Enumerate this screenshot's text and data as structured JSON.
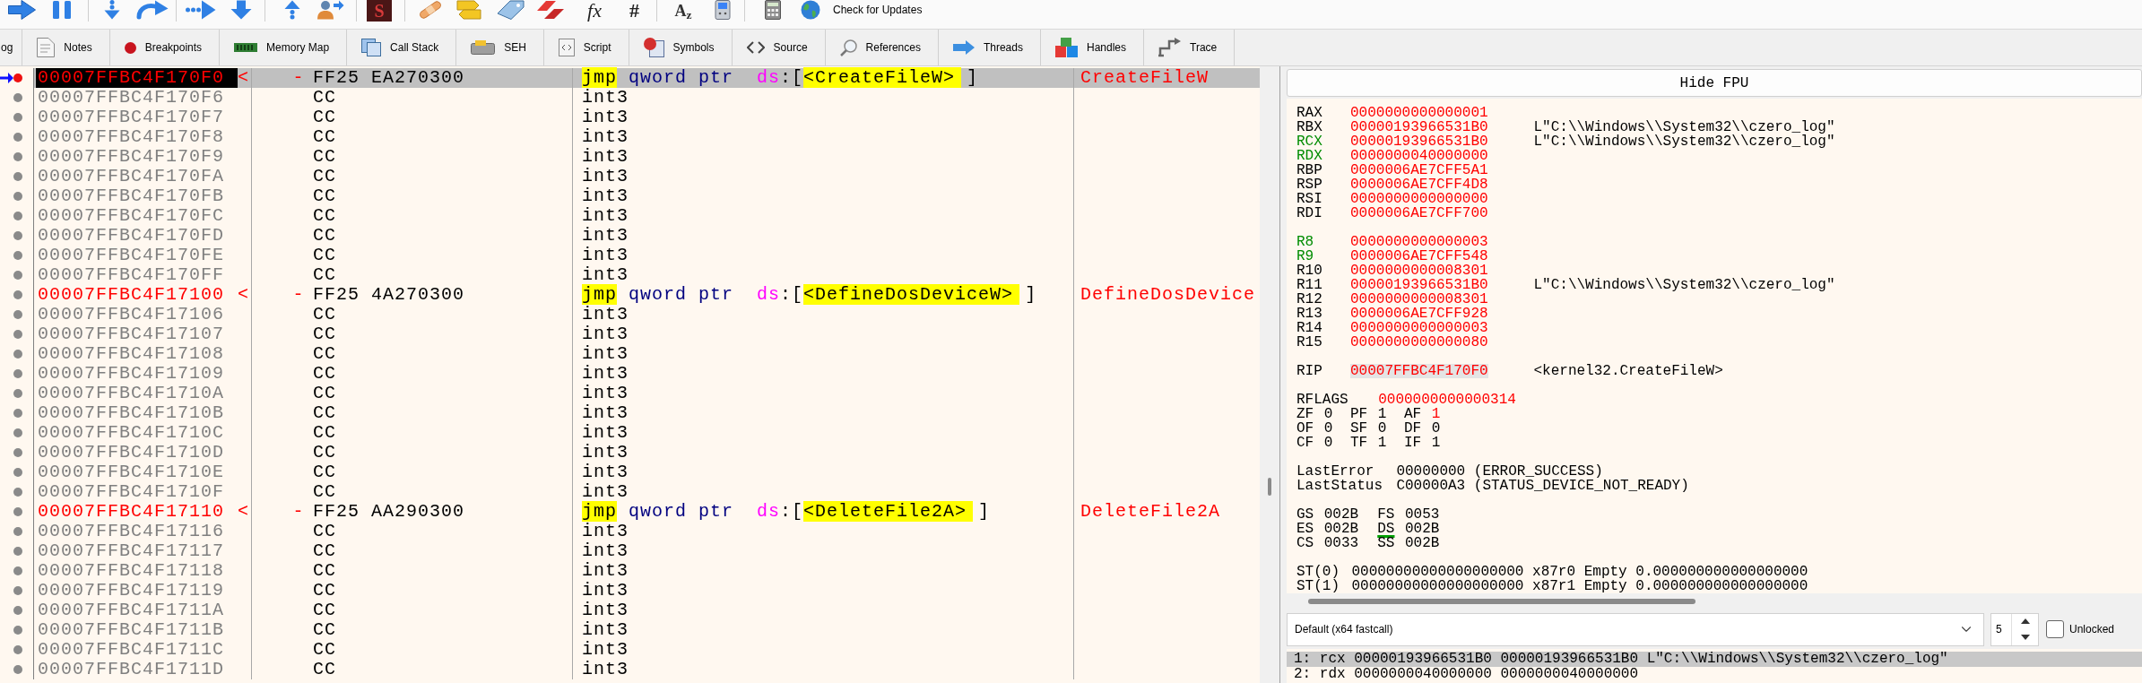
{
  "toolbar": {
    "letter_button": "S",
    "fx_button": "fx",
    "hash_button": "#",
    "az_button": "A$_{z}$",
    "updates_button": "Check for Updates"
  },
  "tabs": [
    {
      "label": "og",
      "kind": "log",
      "selected": false
    },
    {
      "label": "Notes",
      "kind": "notes",
      "selected": false
    },
    {
      "label": "Breakpoints",
      "kind": "breakpoints",
      "selected": false
    },
    {
      "label": "Memory Map",
      "kind": "memory",
      "selected": false
    },
    {
      "label": "Call Stack",
      "kind": "callstack",
      "selected": false
    },
    {
      "label": "SEH",
      "kind": "seh",
      "selected": false
    },
    {
      "label": "Script",
      "kind": "script",
      "selected": false
    },
    {
      "label": "Symbols",
      "kind": "symbols",
      "selected": false
    },
    {
      "label": "Source",
      "kind": "source",
      "selected": false
    },
    {
      "label": "References",
      "kind": "references",
      "selected": false
    },
    {
      "label": "Threads",
      "kind": "threads",
      "selected": false
    },
    {
      "label": "Handles",
      "kind": "handles",
      "selected": false
    },
    {
      "label": "Trace",
      "kind": "trace",
      "selected": false
    }
  ],
  "disassembly": {
    "rows": [
      {
        "address": "00007FFBC4F170F0",
        "address_mark": "<",
        "branch_mark": "-",
        "bytes": "FF25 EA270300",
        "instruction": [
          {
            "text": "jmp",
            "kind": "branch"
          },
          {
            "text": "qword ptr",
            "kind": "size"
          },
          {
            "text": "ds",
            "kind": "segment"
          },
          {
            "text": ":[",
            "kind": "open"
          },
          {
            "text": "<CreateFileW>",
            "kind": "symbol"
          },
          {
            "text": "]",
            "kind": "close"
          }
        ],
        "comment": "CreateFileW",
        "labeled": true,
        "current": true,
        "selected": true,
        "breakpoint": true
      },
      {
        "address": "00007FFBC4F170F6",
        "bytes": "CC",
        "instruction": [
          {
            "text": "int3",
            "kind": "mnemonic"
          }
        ],
        "labeled": false,
        "current": false,
        "selected": false,
        "breakpoint": false
      },
      {
        "address": "00007FFBC4F170F7",
        "bytes": "CC",
        "instruction": [
          {
            "text": "int3",
            "kind": "mnemonic"
          }
        ],
        "labeled": false,
        "current": false,
        "selected": false,
        "breakpoint": false
      },
      {
        "address": "00007FFBC4F170F8",
        "bytes": "CC",
        "instruction": [
          {
            "text": "int3",
            "kind": "mnemonic"
          }
        ],
        "labeled": false,
        "current": false,
        "selected": false,
        "breakpoint": false
      },
      {
        "address": "00007FFBC4F170F9",
        "bytes": "CC",
        "instruction": [
          {
            "text": "int3",
            "kind": "mnemonic"
          }
        ],
        "labeled": false,
        "current": false,
        "selected": false,
        "breakpoint": false
      },
      {
        "address": "00007FFBC4F170FA",
        "bytes": "CC",
        "instruction": [
          {
            "text": "int3",
            "kind": "mnemonic"
          }
        ],
        "labeled": false,
        "current": false,
        "selected": false,
        "breakpoint": false
      },
      {
        "address": "00007FFBC4F170FB",
        "bytes": "CC",
        "instruction": [
          {
            "text": "int3",
            "kind": "mnemonic"
          }
        ],
        "labeled": false,
        "current": false,
        "selected": false,
        "breakpoint": false
      },
      {
        "address": "00007FFBC4F170FC",
        "bytes": "CC",
        "instruction": [
          {
            "text": "int3",
            "kind": "mnemonic"
          }
        ],
        "labeled": false,
        "current": false,
        "selected": false,
        "breakpoint": false
      },
      {
        "address": "00007FFBC4F170FD",
        "bytes": "CC",
        "instruction": [
          {
            "text": "int3",
            "kind": "mnemonic"
          }
        ],
        "labeled": false,
        "current": false,
        "selected": false,
        "breakpoint": false
      },
      {
        "address": "00007FFBC4F170FE",
        "bytes": "CC",
        "instruction": [
          {
            "text": "int3",
            "kind": "mnemonic"
          }
        ],
        "labeled": false,
        "current": false,
        "selected": false,
        "breakpoint": false
      },
      {
        "address": "00007FFBC4F170FF",
        "bytes": "CC",
        "instruction": [
          {
            "text": "int3",
            "kind": "mnemonic"
          }
        ],
        "labeled": false,
        "current": false,
        "selected": false,
        "breakpoint": false
      },
      {
        "address": "00007FFBC4F17100",
        "address_mark": "<",
        "branch_mark": "-",
        "bytes": "FF25 4A270300",
        "instruction": [
          {
            "text": "jmp",
            "kind": "branch"
          },
          {
            "text": "qword ptr",
            "kind": "size"
          },
          {
            "text": "ds",
            "kind": "segment"
          },
          {
            "text": ":[",
            "kind": "open"
          },
          {
            "text": "<DefineDosDeviceW>",
            "kind": "symbol"
          },
          {
            "text": "]",
            "kind": "close"
          }
        ],
        "comment": "DefineDosDevice",
        "labeled": true,
        "current": false,
        "selected": false,
        "breakpoint": false
      },
      {
        "address": "00007FFBC4F17106",
        "bytes": "CC",
        "instruction": [
          {
            "text": "int3",
            "kind": "mnemonic"
          }
        ],
        "labeled": false,
        "current": false,
        "selected": false,
        "breakpoint": false
      },
      {
        "address": "00007FFBC4F17107",
        "bytes": "CC",
        "instruction": [
          {
            "text": "int3",
            "kind": "mnemonic"
          }
        ],
        "labeled": false,
        "current": false,
        "selected": false,
        "breakpoint": false
      },
      {
        "address": "00007FFBC4F17108",
        "bytes": "CC",
        "instruction": [
          {
            "text": "int3",
            "kind": "mnemonic"
          }
        ],
        "labeled": false,
        "current": false,
        "selected": false,
        "breakpoint": false
      },
      {
        "address": "00007FFBC4F17109",
        "bytes": "CC",
        "instruction": [
          {
            "text": "int3",
            "kind": "mnemonic"
          }
        ],
        "labeled": false,
        "current": false,
        "selected": false,
        "breakpoint": false
      },
      {
        "address": "00007FFBC4F1710A",
        "bytes": "CC",
        "instruction": [
          {
            "text": "int3",
            "kind": "mnemonic"
          }
        ],
        "labeled": false,
        "current": false,
        "selected": false,
        "breakpoint": false
      },
      {
        "address": "00007FFBC4F1710B",
        "bytes": "CC",
        "instruction": [
          {
            "text": "int3",
            "kind": "mnemonic"
          }
        ],
        "labeled": false,
        "current": false,
        "selected": false,
        "breakpoint": false
      },
      {
        "address": "00007FFBC4F1710C",
        "bytes": "CC",
        "instruction": [
          {
            "text": "int3",
            "kind": "mnemonic"
          }
        ],
        "labeled": false,
        "current": false,
        "selected": false,
        "breakpoint": false
      },
      {
        "address": "00007FFBC4F1710D",
        "bytes": "CC",
        "instruction": [
          {
            "text": "int3",
            "kind": "mnemonic"
          }
        ],
        "labeled": false,
        "current": false,
        "selected": false,
        "breakpoint": false
      },
      {
        "address": "00007FFBC4F1710E",
        "bytes": "CC",
        "instruction": [
          {
            "text": "int3",
            "kind": "mnemonic"
          }
        ],
        "labeled": false,
        "current": false,
        "selected": false,
        "breakpoint": false
      },
      {
        "address": "00007FFBC4F1710F",
        "bytes": "CC",
        "instruction": [
          {
            "text": "int3",
            "kind": "mnemonic"
          }
        ],
        "labeled": false,
        "current": false,
        "selected": false,
        "breakpoint": false
      },
      {
        "address": "00007FFBC4F17110",
        "address_mark": "<",
        "branch_mark": "-",
        "bytes": "FF25 AA290300",
        "instruction": [
          {
            "text": "jmp",
            "kind": "branch"
          },
          {
            "text": "qword ptr",
            "kind": "size"
          },
          {
            "text": "ds",
            "kind": "segment"
          },
          {
            "text": ":[",
            "kind": "open"
          },
          {
            "text": "<DeleteFile2A>",
            "kind": "symbol"
          },
          {
            "text": "]",
            "kind": "close"
          }
        ],
        "comment": "DeleteFile2A",
        "labeled": true,
        "current": false,
        "selected": false,
        "breakpoint": false
      },
      {
        "address": "00007FFBC4F17116",
        "bytes": "CC",
        "instruction": [
          {
            "text": "int3",
            "kind": "mnemonic"
          }
        ],
        "labeled": false,
        "current": false,
        "selected": false,
        "breakpoint": false
      },
      {
        "address": "00007FFBC4F17117",
        "bytes": "CC",
        "instruction": [
          {
            "text": "int3",
            "kind": "mnemonic"
          }
        ],
        "labeled": false,
        "current": false,
        "selected": false,
        "breakpoint": false
      },
      {
        "address": "00007FFBC4F17118",
        "bytes": "CC",
        "instruction": [
          {
            "text": "int3",
            "kind": "mnemonic"
          }
        ],
        "labeled": false,
        "current": false,
        "selected": false,
        "breakpoint": false
      },
      {
        "address": "00007FFBC4F17119",
        "bytes": "CC",
        "instruction": [
          {
            "text": "int3",
            "kind": "mnemonic"
          }
        ],
        "labeled": false,
        "current": false,
        "selected": false,
        "breakpoint": false
      },
      {
        "address": "00007FFBC4F1711A",
        "bytes": "CC",
        "instruction": [
          {
            "text": "int3",
            "kind": "mnemonic"
          }
        ],
        "labeled": false,
        "current": false,
        "selected": false,
        "breakpoint": false
      },
      {
        "address": "00007FFBC4F1711B",
        "bytes": "CC",
        "instruction": [
          {
            "text": "int3",
            "kind": "mnemonic"
          }
        ],
        "labeled": false,
        "current": false,
        "selected": false,
        "breakpoint": false
      },
      {
        "address": "00007FFBC4F1711C",
        "bytes": "CC",
        "instruction": [
          {
            "text": "int3",
            "kind": "mnemonic"
          }
        ],
        "labeled": false,
        "current": false,
        "selected": false,
        "breakpoint": false
      },
      {
        "address": "00007FFBC4F1711D",
        "bytes": "CC",
        "instruction": [
          {
            "text": "int3",
            "kind": "mnemonic"
          }
        ],
        "labeled": false,
        "current": false,
        "selected": false,
        "breakpoint": false
      }
    ]
  },
  "registers": {
    "hide_fpu_button": "Hide FPU",
    "groups": [
      [
        {
          "name": "RAX",
          "value": "0000000000000001",
          "highlighted": false,
          "modified": true,
          "selected": false
        },
        {
          "name": "RBX",
          "value": "00000193966531B0",
          "comment": "L\"C:\\\\Windows\\\\System32\\\\czero_log\"",
          "highlighted": false,
          "modified": true,
          "selected": false
        },
        {
          "name": "RCX",
          "value": "00000193966531B0",
          "comment": "L\"C:\\\\Windows\\\\System32\\\\czero_log\"",
          "highlighted": true,
          "modified": true,
          "selected": false
        },
        {
          "name": "RDX",
          "value": "0000000040000000",
          "highlighted": true,
          "modified": true,
          "selected": false
        },
        {
          "name": "RBP",
          "value": "0000006AE7CFF5A1",
          "highlighted": false,
          "modified": true,
          "selected": false
        },
        {
          "name": "RSP",
          "value": "0000006AE7CFF4D8",
          "highlighted": false,
          "modified": true,
          "selected": false
        },
        {
          "name": "RSI",
          "value": "0000000000000000",
          "highlighted": false,
          "modified": true,
          "selected": false
        },
        {
          "name": "RDI",
          "value": "0000006AE7CFF700",
          "highlighted": false,
          "modified": true,
          "selected": false
        }
      ],
      [
        {
          "name": "R8",
          "value": "0000000000000003",
          "highlighted": true,
          "modified": true,
          "selected": false
        },
        {
          "name": "R9",
          "value": "0000006AE7CFF548",
          "highlighted": true,
          "modified": true,
          "selected": false
        },
        {
          "name": "R10",
          "value": "0000000000008301",
          "highlighted": false,
          "modified": true,
          "selected": false
        },
        {
          "name": "R11",
          "value": "00000193966531B0",
          "comment": "L\"C:\\\\Windows\\\\System32\\\\czero_log\"",
          "highlighted": false,
          "modified": true,
          "selected": false
        },
        {
          "name": "R12",
          "value": "0000000000008301",
          "highlighted": false,
          "modified": true,
          "selected": false
        },
        {
          "name": "R13",
          "value": "0000006AE7CFF928",
          "highlighted": false,
          "modified": true,
          "selected": false
        },
        {
          "name": "R14",
          "value": "0000000000000003",
          "highlighted": false,
          "modified": true,
          "selected": false
        },
        {
          "name": "R15",
          "value": "0000000000000080",
          "highlighted": false,
          "modified": true,
          "selected": false
        }
      ],
      [
        {
          "name": "RIP",
          "value": "00007FFBC4F170F0",
          "comment": "<kernel32.CreateFileW>",
          "highlighted": false,
          "modified": true,
          "selected": true
        }
      ]
    ],
    "rflags": {
      "name": "RFLAGS",
      "value": "0000000000000314",
      "modified": true
    },
    "flag_rows": [
      [
        {
          "name": "ZF",
          "value": "0",
          "modified": false
        },
        {
          "name": "PF",
          "value": "1",
          "modified": false
        },
        {
          "name": "AF",
          "value": "1",
          "modified": true
        }
      ],
      [
        {
          "name": "OF",
          "value": "0",
          "modified": false
        },
        {
          "name": "SF",
          "value": "0",
          "modified": false
        },
        {
          "name": "DF",
          "value": "0",
          "modified": false
        }
      ],
      [
        {
          "name": "CF",
          "value": "0",
          "modified": false
        },
        {
          "name": "TF",
          "value": "1",
          "modified": false
        },
        {
          "name": "IF",
          "value": "1",
          "modified": false
        }
      ]
    ],
    "status": [
      {
        "name": "LastError",
        "value": "00000000",
        "comment": "(ERROR_SUCCESS)"
      },
      {
        "name": "LastStatus",
        "value": "C00000A3",
        "comment": "(STATUS_DEVICE_NOT_READY)"
      }
    ],
    "segment_rows": [
      [
        {
          "name": "GS",
          "value": "002B",
          "highlighted": false
        },
        {
          "name": "FS",
          "value": "0053",
          "highlighted": false
        }
      ],
      [
        {
          "name": "ES",
          "value": "002B",
          "highlighted": false
        },
        {
          "name": "DS",
          "value": "002B",
          "highlighted": true
        }
      ],
      [
        {
          "name": "CS",
          "value": "0033",
          "highlighted": false
        },
        {
          "name": "SS",
          "value": "002B",
          "highlighted": false
        }
      ]
    ],
    "fpu": [
      {
        "name": "ST(0)",
        "value": "00000000000000000000",
        "register": "x87r0",
        "tag": "Empty",
        "float": "0.000000000000000000"
      },
      {
        "name": "ST(1)",
        "value": "00000000000000000000",
        "register": "x87r1",
        "tag": "Empty",
        "float": "0.000000000000000000"
      }
    ]
  },
  "call_convention": {
    "value": "Default (x64 fastcall)",
    "count": "5",
    "lock": {
      "label": "Unlocked",
      "checked": false
    }
  },
  "arguments": [
    {
      "text": "1: rcx 00000193966531B0 00000193966531B0 L\"C:\\\\Windows\\\\System32\\\\czero_log\"",
      "selected": true
    },
    {
      "text": "2: rdx 0000000040000000 0000000040000000",
      "selected": false
    }
  ]
}
